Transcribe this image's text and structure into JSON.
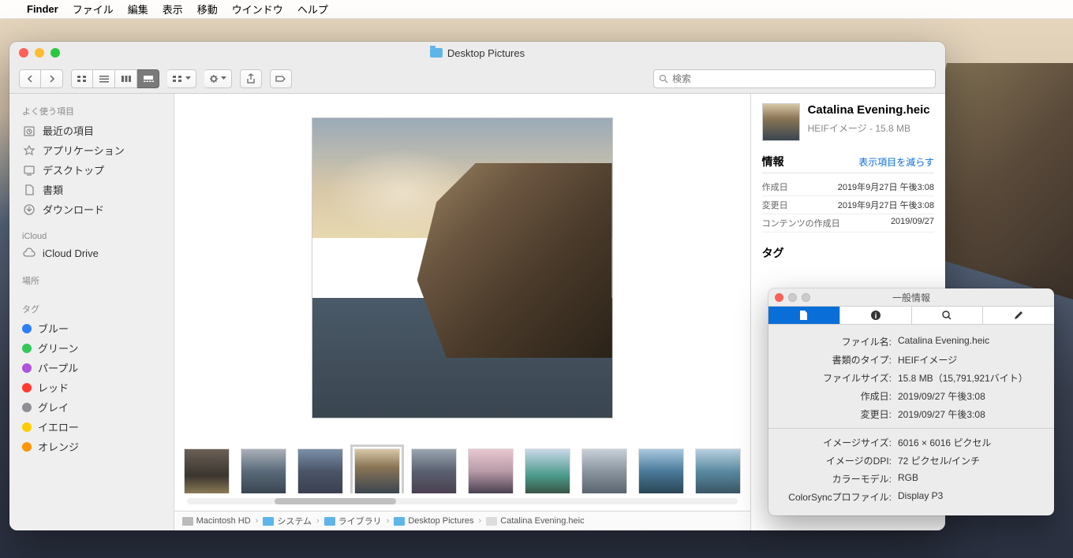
{
  "menubar": {
    "app": "Finder",
    "items": [
      "ファイル",
      "編集",
      "表示",
      "移動",
      "ウインドウ",
      "ヘルプ"
    ]
  },
  "window": {
    "title": "Desktop Pictures",
    "search_placeholder": "検索"
  },
  "sidebar": {
    "sections": [
      {
        "header": "よく使う項目",
        "items": [
          {
            "label": "最近の項目",
            "icon": "clock"
          },
          {
            "label": "アプリケーション",
            "icon": "apps"
          },
          {
            "label": "デスクトップ",
            "icon": "desktop"
          },
          {
            "label": "書類",
            "icon": "doc"
          },
          {
            "label": "ダウンロード",
            "icon": "download"
          }
        ]
      },
      {
        "header": "iCloud",
        "items": [
          {
            "label": "iCloud Drive",
            "icon": "cloud"
          }
        ]
      },
      {
        "header": "場所",
        "items": []
      },
      {
        "header": "タグ",
        "items": [
          {
            "label": "ブルー",
            "color": "#2d7ff9"
          },
          {
            "label": "グリーン",
            "color": "#34c759"
          },
          {
            "label": "パープル",
            "color": "#af52de"
          },
          {
            "label": "レッド",
            "color": "#ff3b30"
          },
          {
            "label": "グレイ",
            "color": "#8e8e93"
          },
          {
            "label": "イエロー",
            "color": "#ffcc00"
          },
          {
            "label": "オレンジ",
            "color": "#ff9500"
          }
        ]
      }
    ]
  },
  "pathbar": [
    "Macintosh HD",
    "システム",
    "ライブラリ",
    "Desktop Pictures",
    "Catalina Evening.heic"
  ],
  "info": {
    "filename": "Catalina Evening.heic",
    "subtitle": "HEIFイメージ - 15.8 MB",
    "section_info": "情報",
    "show_less": "表示項目を減らす",
    "rows": [
      {
        "k": "作成日",
        "v": "2019年9月27日 午後3:08"
      },
      {
        "k": "変更日",
        "v": "2019年9月27日 午後3:08"
      },
      {
        "k": "コンテンツの作成日",
        "v": "2019/09/27"
      }
    ],
    "section_tags": "タグ"
  },
  "inspector": {
    "title": "一般情報",
    "rows1": [
      {
        "k": "ファイル名:",
        "v": "Catalina Evening.heic"
      },
      {
        "k": "書類のタイプ:",
        "v": "HEIFイメージ"
      },
      {
        "k": "ファイルサイズ:",
        "v": "15.8 MB（15,791,921バイト）"
      },
      {
        "k": "作成日:",
        "v": "2019/09/27 午後3:08"
      },
      {
        "k": "変更日:",
        "v": "2019/09/27 午後3:08"
      }
    ],
    "rows2": [
      {
        "k": "イメージサイズ:",
        "v": "6016 × 6016 ピクセル"
      },
      {
        "k": "イメージのDPI:",
        "v": "72 ピクセル/インチ"
      },
      {
        "k": "カラーモデル:",
        "v": "RGB"
      },
      {
        "k": "ColorSyncプロファイル:",
        "v": "Display P3"
      }
    ]
  }
}
